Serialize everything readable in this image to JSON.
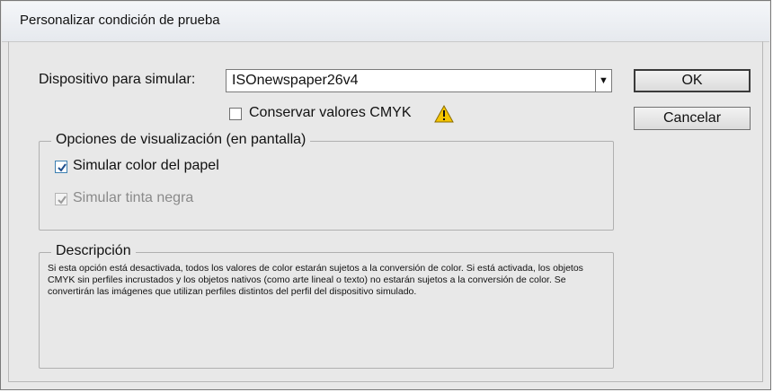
{
  "dialog": {
    "title": "Personalizar condición de prueba"
  },
  "device": {
    "label": "Dispositivo para simular:",
    "selected_value": "ISOnewspaper26v4"
  },
  "preserve_cmyk": {
    "label": "Conservar valores CMYK",
    "checked": false
  },
  "display_options": {
    "legend": "Opciones de visualización (en pantalla)",
    "simulate_paper_color": {
      "label": "Simular color del papel",
      "checked": true
    },
    "simulate_black_ink": {
      "label": "Simular tinta negra",
      "checked": true,
      "disabled": true
    }
  },
  "description": {
    "legend": "Descripción",
    "text": "Si esta opción está desactivada, todos los valores de color estarán sujetos a la conversión de color. Si está activada, los objetos CMYK sin perfiles incrustados y los objetos nativos (como arte lineal o texto) no estarán sujetos a la conversión de color. Se convertirán las imágenes que utilizan perfiles distintos del perfil del dispositivo simulado."
  },
  "buttons": {
    "ok_label": "OK",
    "cancel_label": "Cancelar"
  },
  "icons": {
    "warning": "warning-icon",
    "dropdown": "chevron-down-icon",
    "check": "checkmark-icon"
  },
  "colors": {
    "warning_yellow": "#f5c400",
    "checkmark_blue": "#1f4e8c"
  }
}
